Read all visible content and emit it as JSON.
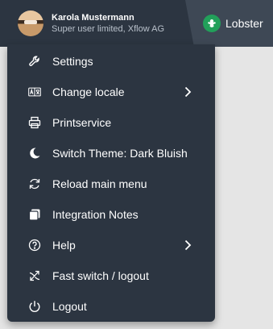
{
  "user": {
    "name": "Karola Mustermann",
    "role": "Super user limited, Xflow AG"
  },
  "brand": {
    "name": "Lobster"
  },
  "menu": {
    "items": [
      {
        "label": "Settings",
        "icon": "wrench-icon"
      },
      {
        "label": "Change locale",
        "icon": "locale-icon",
        "submenu": true
      },
      {
        "label": "Printservice",
        "icon": "printer-icon"
      },
      {
        "label": "Switch Theme: Dark Bluish",
        "icon": "moon-icon"
      },
      {
        "label": "Reload main menu",
        "icon": "reload-icon"
      },
      {
        "label": "Integration Notes",
        "icon": "notes-icon"
      },
      {
        "label": "Help",
        "icon": "help-icon",
        "submenu": true
      },
      {
        "label": "Fast switch / logout",
        "icon": "fast-switch-icon"
      },
      {
        "label": "Logout",
        "icon": "power-icon"
      }
    ]
  },
  "colors": {
    "menu_bg": "#2c3541",
    "brand_bg": "#3e4855",
    "brand_logo": "#22a05a",
    "text": "#ffffff",
    "subtext": "#b8c0ca"
  }
}
